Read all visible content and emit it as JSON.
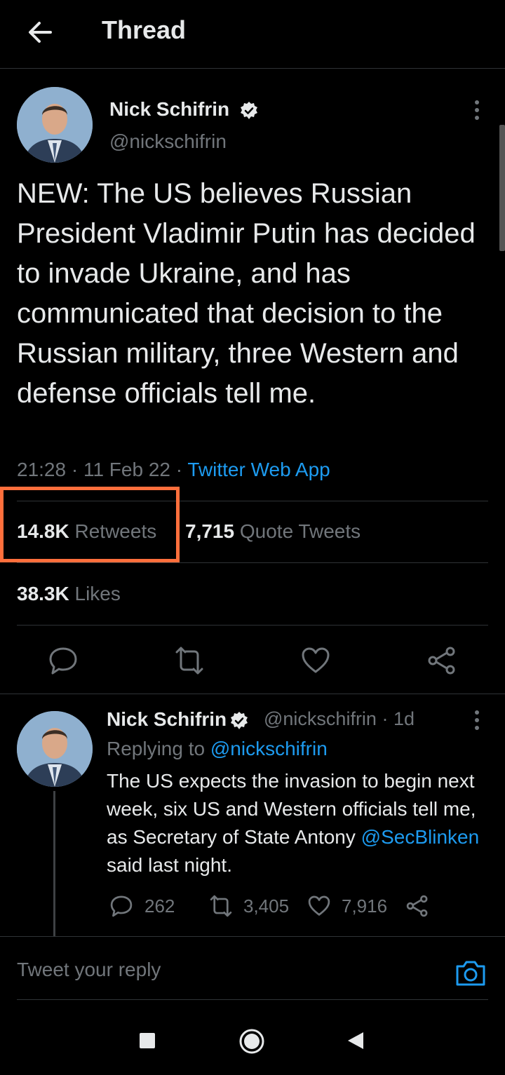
{
  "header": {
    "title": "Thread",
    "back_icon": "arrow-left-icon"
  },
  "tweet": {
    "author_name": "Nick Schifrin",
    "handle": "@nickschifrin",
    "text": "NEW: The US believes Russian President Vladimir Putin has decided to invade Ukraine, and has communicated that decision to the Russian military, three Western and defense officials tell me.",
    "time": "21:28 · 11 Feb 22 · ",
    "source": "Twitter Web App",
    "retweets_count": "14.8K",
    "retweets_label": "Retweets",
    "quotes_count": "7,715",
    "quotes_label": "Quote Tweets",
    "likes_count": "38.3K",
    "likes_label": "Likes"
  },
  "reply": {
    "author_name": "Nick Schifrin",
    "handle_time": "@nickschifrin · 1d",
    "replying_prefix": "Replying to ",
    "replying_handle": "@nickschifrin",
    "text_part1": "The US expects the invasion to begin next week, six US and Western officials tell me, as Secretary of State Antony ",
    "mention": "@SecBlinken",
    "text_part2": " said last night.",
    "reply_count": "262",
    "retweet_count": "3,405",
    "like_count": "7,916"
  },
  "composer": {
    "placeholder": "Tweet your reply"
  },
  "colors": {
    "background": "#000000",
    "accent": "#1d9bf0",
    "highlight": "#ff6f3c",
    "muted": "#71767b"
  }
}
